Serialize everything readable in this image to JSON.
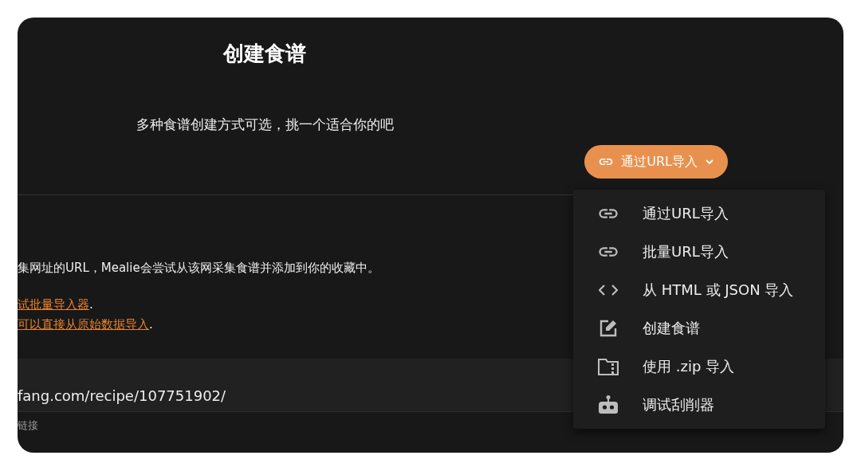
{
  "header": {
    "title": "创建食谱",
    "subtitle": "多种食谱创建方式可选，挑一个适合你的吧"
  },
  "import_button": {
    "label": "通过URL导入",
    "expanded": true
  },
  "menu": {
    "items": [
      {
        "label": "通过URL导入"
      },
      {
        "label": "批量URL导入"
      },
      {
        "label": "从 HTML 或 JSON 导入"
      },
      {
        "label": "创建食谱"
      },
      {
        "label": "使用 .zip 导入"
      },
      {
        "label": "调试刮削器"
      }
    ]
  },
  "description": {
    "text": "集网址的URL，Mealie会尝试从该网采集食谱并添加到你的收藏中。",
    "links": [
      {
        "text": "试批量导入器",
        "after": "."
      },
      {
        "text": "可以直接从原始数据导入",
        "after": "."
      }
    ]
  },
  "url_field": {
    "value": "fang.com/recipe/107751902/",
    "hint": "链接"
  }
}
